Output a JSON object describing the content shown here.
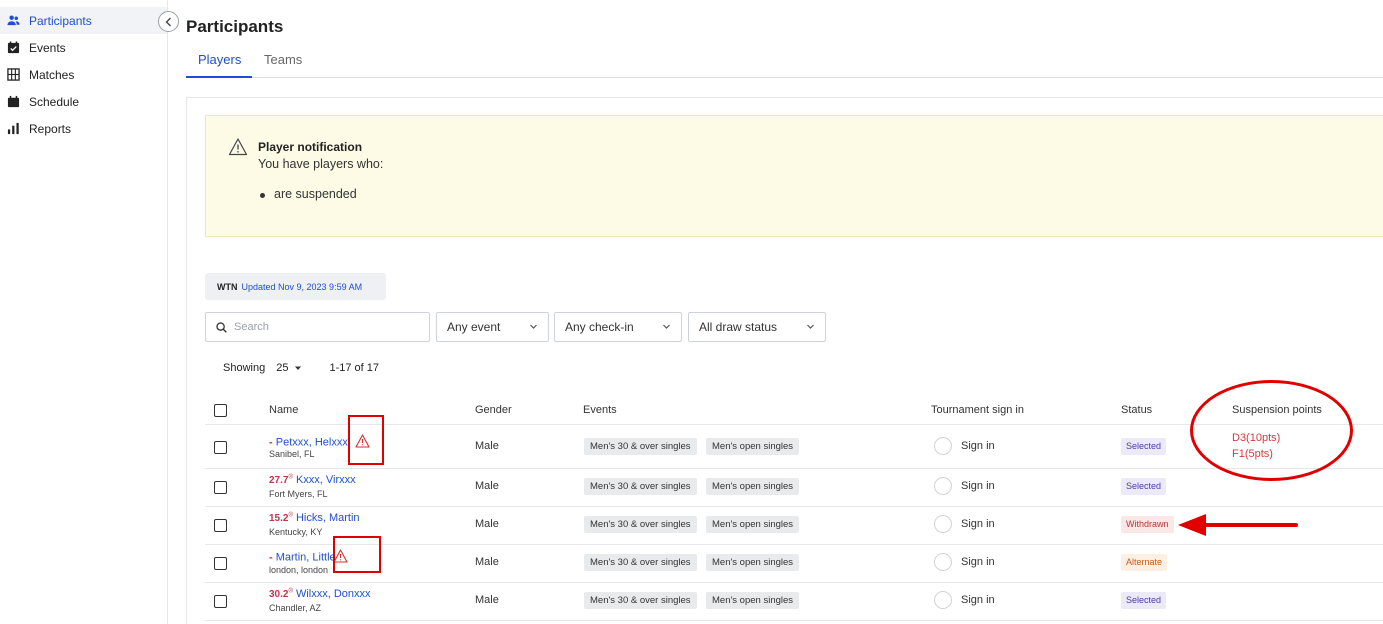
{
  "sidebar": {
    "items": [
      {
        "label": "Participants",
        "icon": "users-icon",
        "active": true
      },
      {
        "label": "Events",
        "icon": "calendar-check-icon"
      },
      {
        "label": "Matches",
        "icon": "grid-icon"
      },
      {
        "label": "Schedule",
        "icon": "calendar-icon"
      },
      {
        "label": "Reports",
        "icon": "bar-chart-icon"
      }
    ]
  },
  "header": {
    "title": "Participants",
    "tabs": [
      {
        "label": "Players",
        "active": true
      },
      {
        "label": "Teams"
      }
    ]
  },
  "notification": {
    "title": "Player notification",
    "text": "You have players who:",
    "bullets": [
      "are suspended"
    ]
  },
  "wtn": {
    "label": "WTN",
    "updated": "Updated Nov 9, 2023 9:59 AM"
  },
  "filters": {
    "search_placeholder": "Search",
    "event": "Any event",
    "checkin": "Any check-in",
    "draw_status": "All draw status"
  },
  "pagination": {
    "showing_label": "Showing",
    "page_size": "25",
    "range": "1-17 of 17"
  },
  "table": {
    "columns": [
      "Name",
      "Gender",
      "Events",
      "Tournament sign in",
      "Status",
      "Suspension points"
    ],
    "rows": [
      {
        "rating": "-",
        "name": "Petxxx, Helxxx",
        "location": "Sanibel, FL",
        "warning": true,
        "gender": "Male",
        "events": [
          "Men's 30 & over singles",
          "Men's open singles"
        ],
        "signin": "Sign in",
        "status": "Selected",
        "suspension": [
          "D3(10pts)",
          "F1(5pts)"
        ]
      },
      {
        "rating": "27.7",
        "name": "Kxxx, Virxxx",
        "location": "Fort Myers, FL",
        "warning": false,
        "gender": "Male",
        "events": [
          "Men's 30 & over singles",
          "Men's open singles"
        ],
        "signin": "Sign in",
        "status": "Selected",
        "suspension": []
      },
      {
        "rating": "15.2",
        "name": "Hicks, Martin",
        "location": "Kentucky, KY",
        "warning": false,
        "gender": "Male",
        "events": [
          "Men's 30 & over singles",
          "Men's open singles"
        ],
        "signin": "Sign in",
        "status": "Withdrawn",
        "suspension": []
      },
      {
        "rating": "-",
        "name": "Martin, Little",
        "location": "london, london",
        "warning": true,
        "gender": "Male",
        "events": [
          "Men's 30 & over singles",
          "Men's open singles"
        ],
        "signin": "Sign in",
        "status": "Alternate",
        "suspension": []
      },
      {
        "rating": "30.2",
        "name": "Wilxxx, Donxxx",
        "location": "Chandler, AZ",
        "warning": false,
        "gender": "Male",
        "events": [
          "Men's 30 & over singles",
          "Men's open singles"
        ],
        "signin": "Sign in",
        "status": "Selected",
        "suspension": []
      }
    ]
  },
  "colors": {
    "accent": "#1f4fd1",
    "annotation": "#e00000",
    "rating": "#c2334d",
    "notice_bg": "#fdfbe6"
  }
}
